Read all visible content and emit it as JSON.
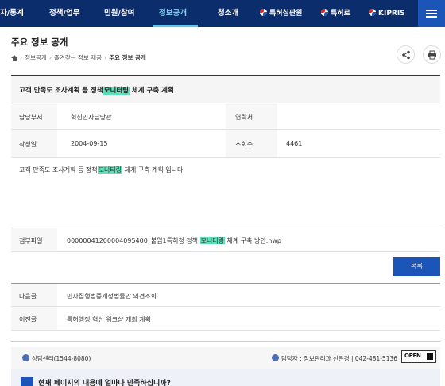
{
  "nav": {
    "items": [
      "자/통계",
      "정책/업무",
      "민원/참여",
      "정보공개",
      "청소개"
    ],
    "links": [
      "특허심판원",
      "특허로",
      "KIPRIS"
    ]
  },
  "header": {
    "title": "주요 정보 공개",
    "breadcrumb": [
      "정보공개",
      "즐겨찾는 정보 제공",
      "주요 정보 공개"
    ]
  },
  "record": {
    "title_prefix": "고객 만족도 조사계획 등 정책",
    "title_highlight": "모니터링",
    "title_suffix": " 체계 구축 계획",
    "dept_label": "담당부서",
    "dept_value": "혁신인사담당관",
    "contact_label": "연락처",
    "contact_value": "",
    "date_label": "작성일",
    "date_value": "2004-09-15",
    "views_label": "조회수",
    "views_value": "4461",
    "body_prefix": "고객 만족도 조사계획 등 정책",
    "body_highlight": "모니터링",
    "body_suffix": " 체계 구축 계획 입니다",
    "attach_label": "첨부파일",
    "attach_prefix": "00000041200004095400_붙임1특허청 정책 ",
    "attach_highlight": "모니터링",
    "attach_suffix": " 체계 구축 방안.hwp",
    "list_button": "목록",
    "next_label": "다음글",
    "next_value": "민사집행법중개정법률안 의견조회",
    "prev_label": "이전글",
    "prev_value": "특허행정 혁신 워크샵 개최 계획"
  },
  "footer": {
    "call_center": "상담센터(1544-8080)",
    "manager": "담당자 : 정보관리과 신은경 | 042-481-5136",
    "open_badge": "OPEN",
    "survey": "현재 페이지의 내용에 얼마나 만족하십니까?"
  }
}
